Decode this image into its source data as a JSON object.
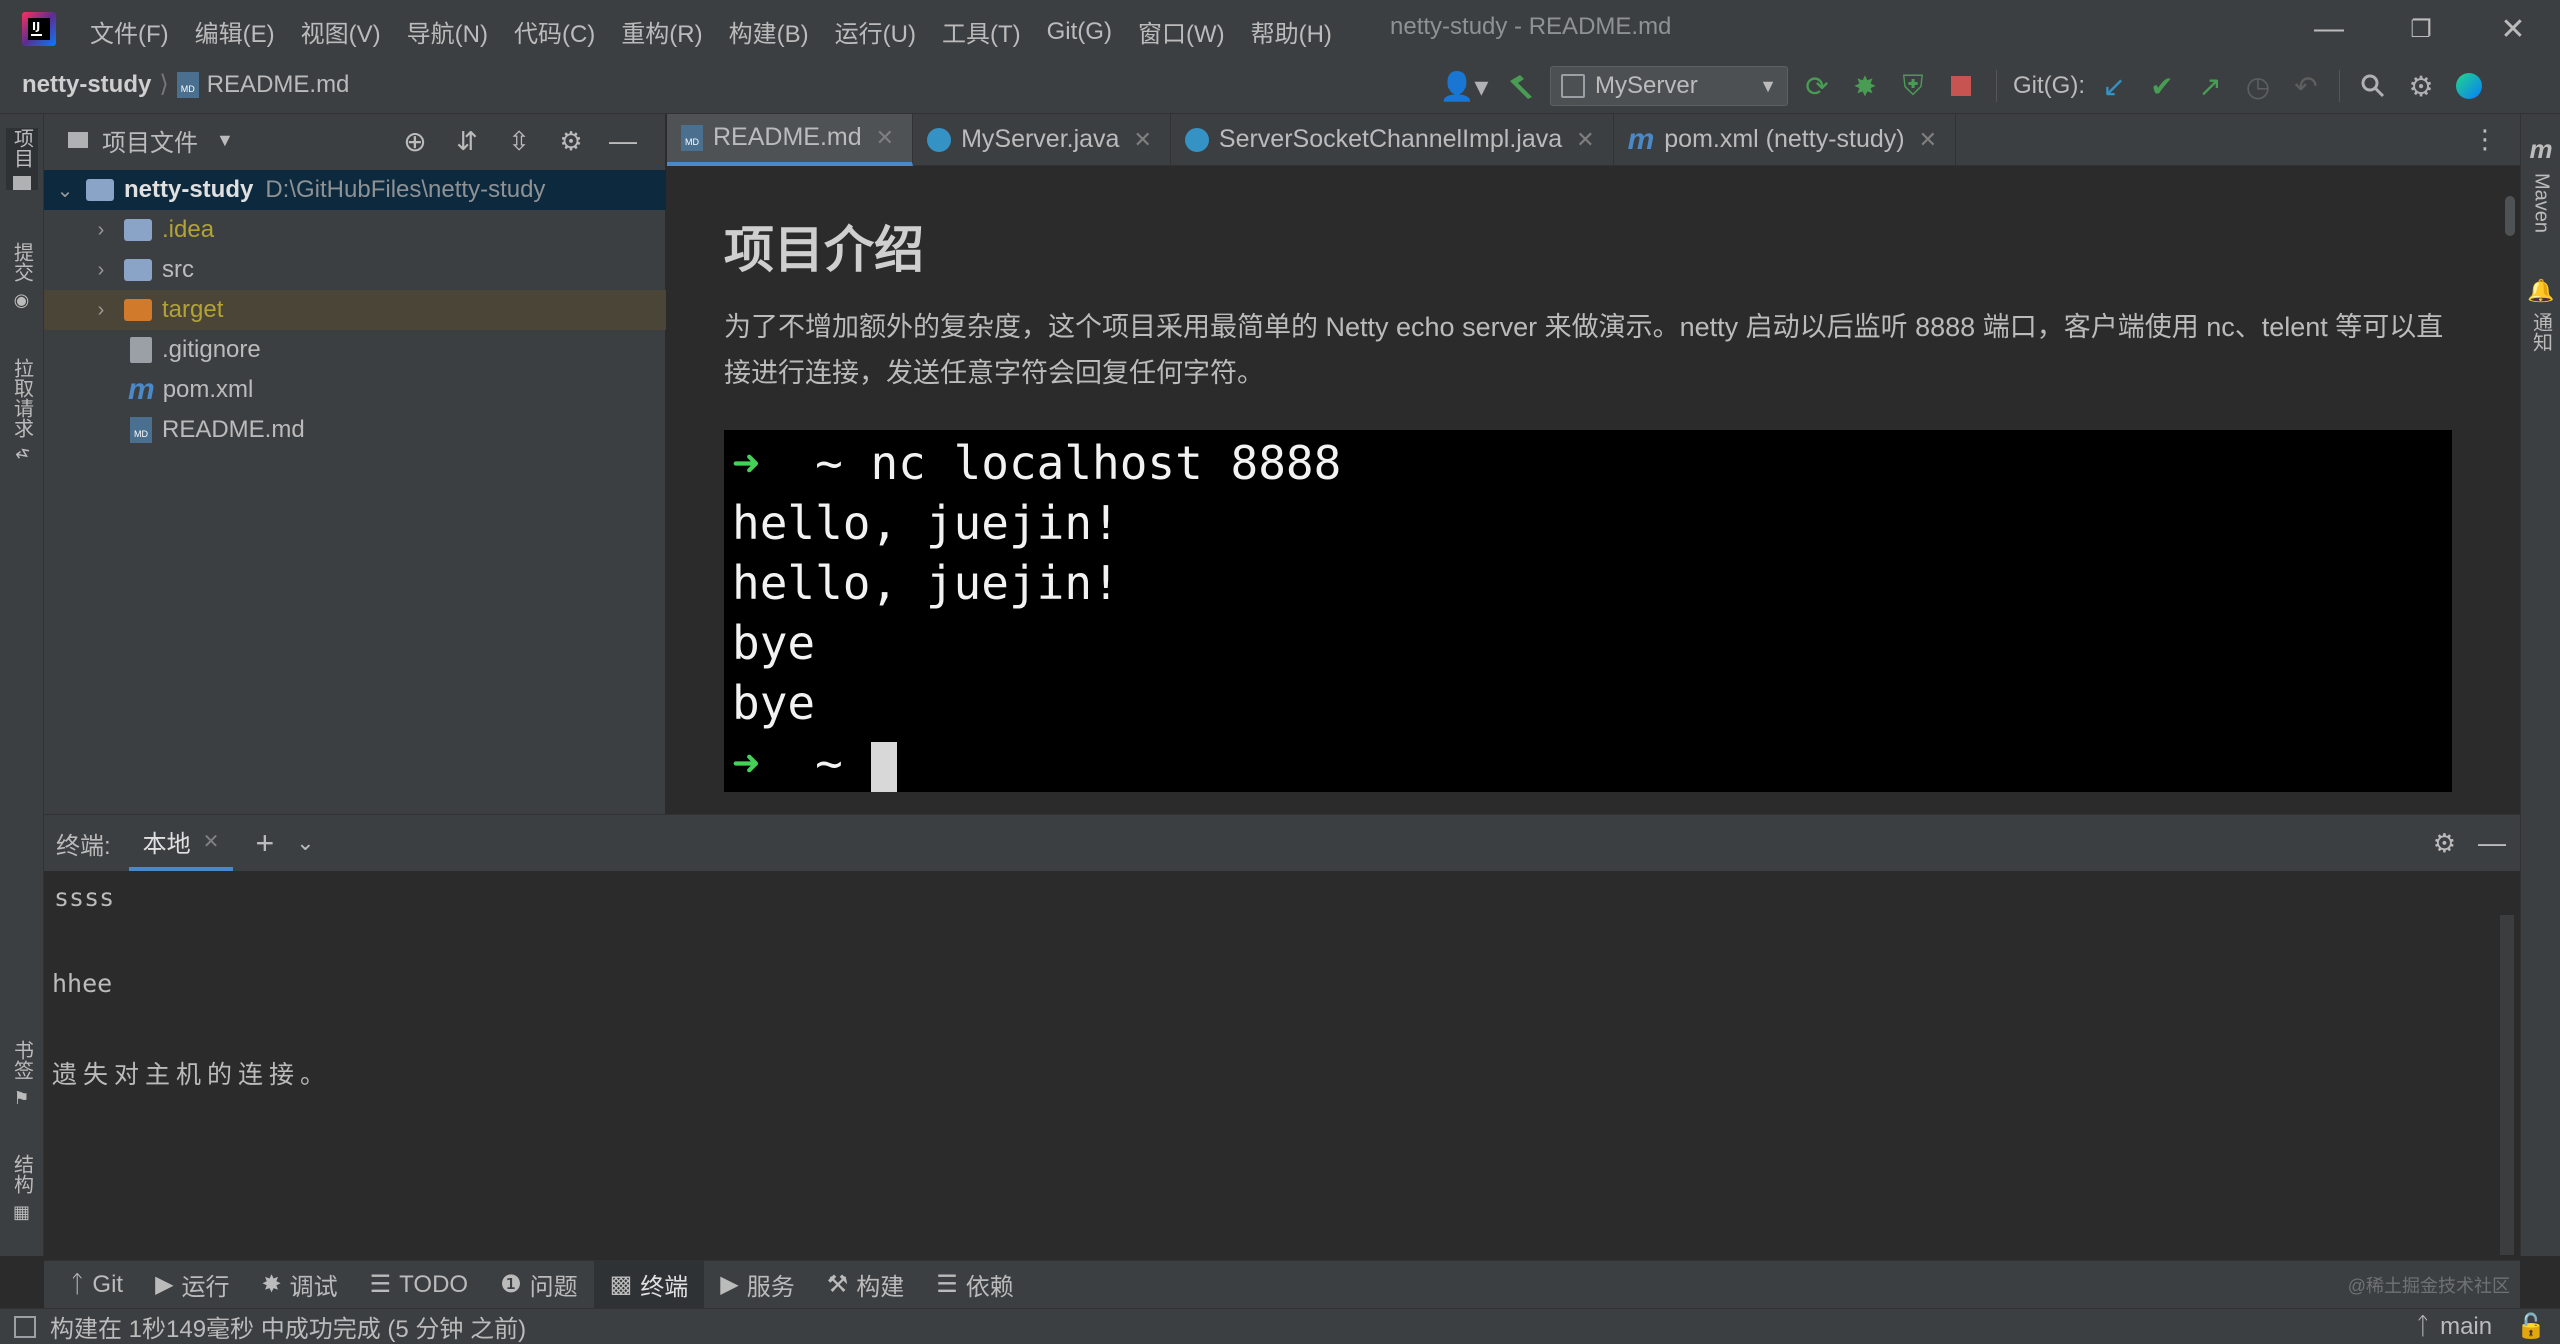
{
  "app": {
    "title": "netty-study - README.md"
  },
  "menu": [
    "文件(F)",
    "编辑(E)",
    "视图(V)",
    "导航(N)",
    "代码(C)",
    "重构(R)",
    "构建(B)",
    "运行(U)",
    "工具(T)",
    "Git(G)",
    "窗口(W)",
    "帮助(H)"
  ],
  "breadcrumb": {
    "project": "netty-study",
    "file": "README.md"
  },
  "toolbar": {
    "run_config": "MyServer",
    "git_label": "Git(G):"
  },
  "left_strip": {
    "project": "项目",
    "commit": "提交",
    "pull_requests": "拉取请求",
    "bookmarks": "书签",
    "structure": "结构"
  },
  "right_strip": {
    "maven": "Maven",
    "notifications": "通知"
  },
  "project_panel": {
    "title": "项目文件",
    "root": {
      "name": "netty-study",
      "path": "D:\\GitHubFiles\\netty-study"
    },
    "items": [
      {
        "name": ".idea",
        "color": "#b3a236"
      },
      {
        "name": "src",
        "color": "#bbbbbb"
      },
      {
        "name": "target",
        "color": "#b3a236"
      },
      {
        "name": ".gitignore",
        "color": "#bbbbbb"
      },
      {
        "name": "pom.xml",
        "color": "#bbbbbb"
      },
      {
        "name": "README.md",
        "color": "#bbbbbb"
      }
    ]
  },
  "editor_tabs": [
    {
      "label": "README.md",
      "icon": "markdown-icon",
      "active": true
    },
    {
      "label": "MyServer.java",
      "icon": "java-class-icon",
      "active": false
    },
    {
      "label": "ServerSocketChannelImpl.java",
      "icon": "java-class-icon",
      "active": false
    },
    {
      "label": "pom.xml (netty-study)",
      "icon": "maven-icon",
      "active": false
    }
  ],
  "editor": {
    "heading": "项目介绍",
    "paragraph": "为了不增加额外的复杂度，这个项目采用最简单的 Netty echo server 来做演示。netty 启动以后监听 8888 端口，客户端使用 nc、telent 等可以直接进行连接，发送任意字符会回复任何字符。",
    "terminal_image": {
      "lines": [
        "~ nc localhost 8888",
        "hello, juejin!",
        "hello, juejin!",
        "bye",
        "bye",
        "~"
      ]
    }
  },
  "terminal": {
    "label": "终端:",
    "tab": "本地",
    "output": [
      "ssss",
      "hhee",
      "遗失对主机的连接。"
    ]
  },
  "tool_tabs": [
    {
      "label": "Git",
      "icon": "git-branch-icon"
    },
    {
      "label": "运行",
      "icon": "run-icon"
    },
    {
      "label": "调试",
      "icon": "debug-icon"
    },
    {
      "label": "TODO",
      "icon": "list-icon"
    },
    {
      "label": "问题",
      "icon": "info-icon"
    },
    {
      "label": "终端",
      "icon": "terminal-icon",
      "active": true
    },
    {
      "label": "服务",
      "icon": "services-icon"
    },
    {
      "label": "构建",
      "icon": "hammer-icon"
    },
    {
      "label": "依赖",
      "icon": "layers-icon"
    }
  ],
  "status": {
    "message": "构建在 1秒149毫秒 中成功完成 (5 分钟 之前)",
    "branch": "main",
    "watermark": "@稀土掘金技术社区"
  },
  "colors": {
    "accent": "#4a88c7",
    "green": "#499c54",
    "red": "#c75450",
    "folder": "#8aa4c8",
    "excluded": "#d17a2c"
  }
}
